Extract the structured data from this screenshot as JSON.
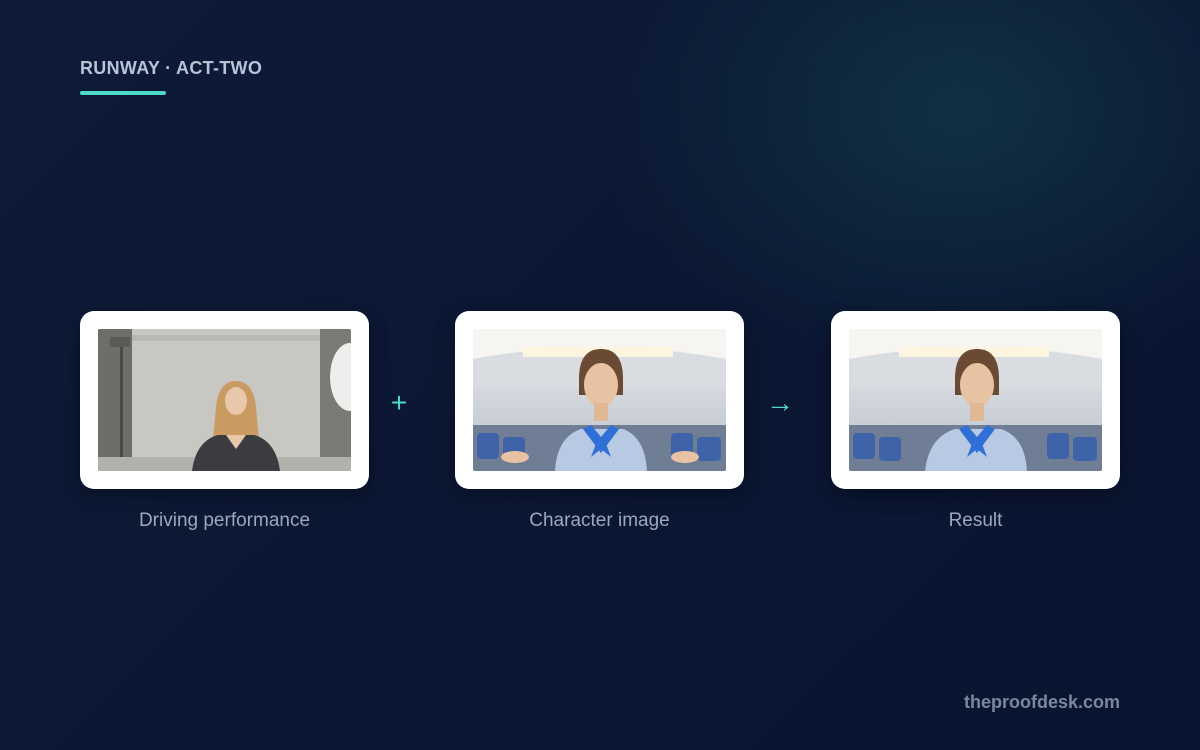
{
  "header": {
    "brand": "RUNWAY · ACT-TWO"
  },
  "steps": [
    {
      "label": "Driving performance",
      "image": "studio-performer-photo"
    },
    {
      "label": "Character image",
      "image": "flight-attendant-cabin-photo"
    },
    {
      "label": "Result",
      "image": "flight-attendant-result-photo"
    }
  ],
  "operators": {
    "plus": "+",
    "arrow": "→"
  },
  "footer": {
    "site": "theproofdesk.com"
  },
  "colors": {
    "accent": "#4ed9c4",
    "background": "#0b1733"
  }
}
